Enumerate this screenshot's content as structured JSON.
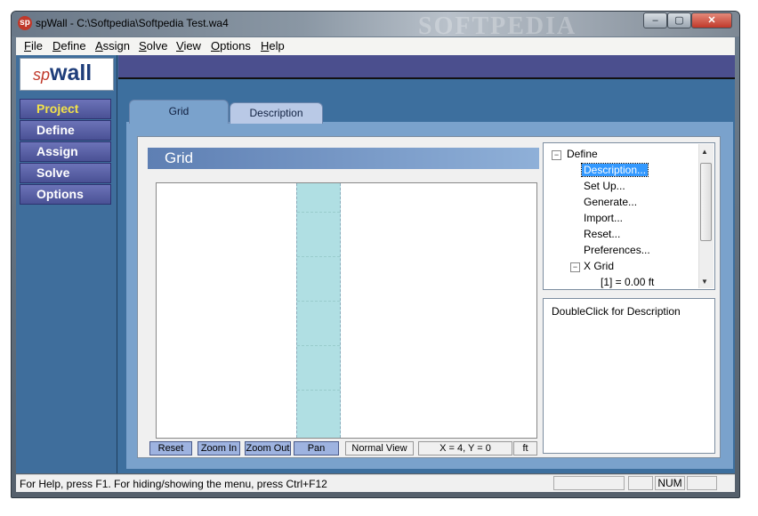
{
  "window": {
    "icon_text": "sp",
    "title": "spWall - C:\\Softpedia\\Softpedia Test.wa4",
    "watermark": "SOFTPEDIA",
    "controls": {
      "minimize": "–",
      "maximize": "▢",
      "close": "✕"
    }
  },
  "menu": [
    "File",
    "Define",
    "Assign",
    "Solve",
    "View",
    "Options",
    "Help"
  ],
  "logo": {
    "sp": "sp",
    "wall": "wall"
  },
  "nav": [
    "Project",
    "Define",
    "Assign",
    "Solve",
    "Options"
  ],
  "tabs": [
    "Grid",
    "Description"
  ],
  "panel": {
    "header": "Grid"
  },
  "toolbar": {
    "reset": "Reset",
    "zoom_in": "Zoom In",
    "zoom_out": "Zoom Out",
    "pan": "Pan",
    "view_mode": "Normal View",
    "coords": "X = 4, Y = 0",
    "units": "ft"
  },
  "tree": {
    "root": "Define",
    "items": [
      "Description...",
      "Set Up...",
      "Generate...",
      "Import...",
      "Reset...",
      "Preferences..."
    ],
    "xgrid_label": "X Grid",
    "xgrid_entry": "[1] =  0.00 ft",
    "selected": "Description..."
  },
  "description_hint": "DoubleClick for Description",
  "statusbar": {
    "help": "For Help, press F1. For hiding/showing the menu, press Ctrl+F12",
    "num": "NUM"
  },
  "colors": {
    "client_bg": "#3d6f9e",
    "nav_button": "#5a62a8",
    "active_nav_text": "#f2e24a",
    "canvas_band": "#b0dfe3",
    "selection": "#3399ff"
  }
}
